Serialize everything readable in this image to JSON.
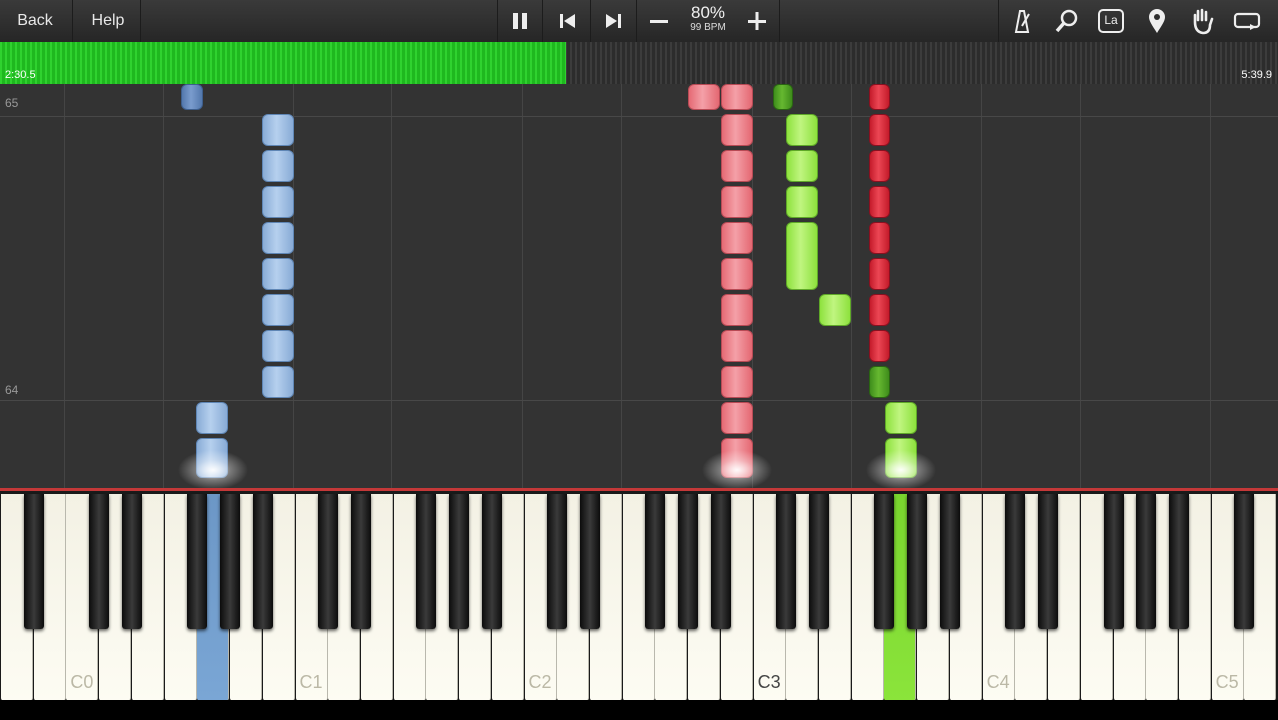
{
  "toolbar": {
    "back_label": "Back",
    "help_label": "Help",
    "speed_percent": "80%",
    "bpm": "99 BPM"
  },
  "icons": {
    "pause": "pause-icon",
    "prev": "skip-back-icon",
    "next": "skip-forward-icon",
    "minus": "minus-icon",
    "plus": "plus-icon",
    "metronome": "metronome-icon",
    "zoom": "magnifier-icon",
    "labels": "key-labels-icon",
    "labels_text": "La",
    "bookmark": "location-pin-icon",
    "hand": "hand-icon",
    "loop": "loop-icon"
  },
  "progress": {
    "elapsed": "2:30.5",
    "total": "5:39.9",
    "fraction": 0.443
  },
  "roll": {
    "measures": [
      "65",
      "64"
    ]
  },
  "keyboard": {
    "octave_labels": [
      "C0",
      "C1",
      "C2",
      "C3",
      "C4",
      "C5"
    ]
  },
  "colors": {
    "left_hand_blue": "#8cb0db",
    "right_hand_red": "#e5535f",
    "accomp_green": "#8be43b",
    "progress_green": "#2fd22f",
    "keyboard_border": "#c43838"
  }
}
